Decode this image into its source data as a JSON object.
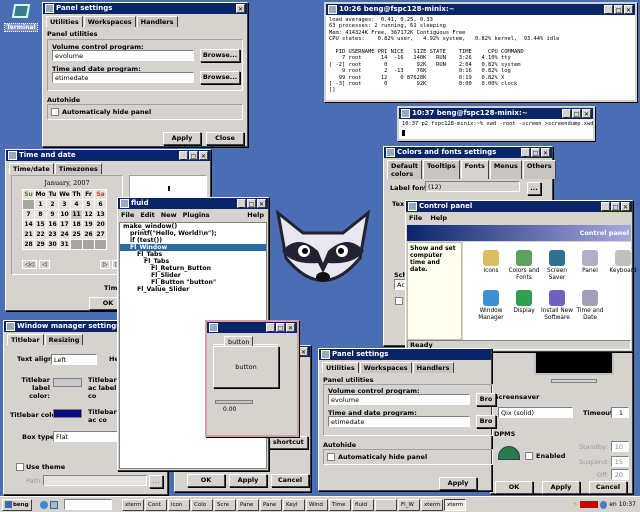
{
  "desktop": {
    "terminal_icon_label": "Terminal"
  },
  "panel_settings_top": {
    "title": "Panel settings",
    "tabs": [
      "Utilities",
      "Workspaces",
      "Handlers"
    ],
    "group_label": "Panel utilities",
    "volume_label": "Volume control program:",
    "volume_value": "evolume",
    "time_label": "Time and date program:",
    "time_value": "etimedate",
    "browse": "Browse...",
    "autohide_label": "Autohide",
    "autohide_check": "Automaticaly hide panel",
    "apply": "Apply",
    "close": "Close"
  },
  "xterm_top": {
    "title": "10:26 beng@fspc128-minix:~",
    "lines": [
      "load averages:  0.41, 0.25, 0.33",
      "63 processes: 2 running, 61 sleeping",
      "Mem: 414324K Free, 367172K Contiguous Free",
      "CPU states:    0.82% user,   4.92% system,   0.82% kernel,  93.44% idle",
      "",
      "  PID USERNAME PRI NICE   SIZE STATE    TIME     CPU COMMAND",
      "    7 root      14  -16   140K   RUN    3:26   4.10% tty",
      "[ -2] root       0         92K   RUN    2:04   0.82% system",
      "    9 root       2  -13    76K          0:16   0.82% log",
      "   99 root      12    0 87628K          0:19   0.82% X",
      "[ -3] root       0         92K          0:00   0.00% clock",
      "[]"
    ]
  },
  "xterm_small": {
    "title": "10:37 beng@fspc128-minix:~",
    "prompt": "10:37 p2 fspc128-minix:~% xwd -root -screen >screendump.xwd"
  },
  "time_and_date": {
    "title": "Time and date",
    "tabs": [
      "Time/date",
      "Timezones"
    ],
    "month": "January, 2007",
    "weekdays": [
      "Su",
      "Mo",
      "Tu",
      "We",
      "Th",
      "Fr",
      "Sa"
    ],
    "days": [
      "",
      "1",
      "2",
      "3",
      "4",
      "5",
      "6",
      "7",
      "8",
      "9",
      "10",
      "11",
      "12",
      "13",
      "14",
      "15",
      "16",
      "17",
      "18",
      "19",
      "20",
      "21",
      "22",
      "23",
      "24",
      "25",
      "26",
      "27",
      "28",
      "29",
      "30",
      "31"
    ],
    "selected_day": "11",
    "nav": [
      "◁◁",
      "◁",
      "▷",
      "▷▷"
    ],
    "time_label_partial": "Tim",
    "ok": "OK"
  },
  "fluid": {
    "title": "fluid",
    "menu": [
      "File",
      "Edit",
      "New",
      "Plugins"
    ],
    "help": "Help",
    "tree": [
      {
        "text": "make_window()",
        "depth": 0,
        "selected": false
      },
      {
        "text": "printf(\"Hello, World!\\n\");",
        "depth": 1,
        "selected": false
      },
      {
        "text": "if (test())",
        "depth": 1,
        "selected": false
      },
      {
        "text": "Fl_Window",
        "depth": 1,
        "selected": true
      },
      {
        "text": "Fl_Tabs",
        "depth": 2,
        "selected": false
      },
      {
        "text": "Fl_Tabs",
        "depth": 3,
        "selected": false
      },
      {
        "text": "Fl_Return_Button",
        "depth": 4,
        "selected": false
      },
      {
        "text": "Fl_Slider",
        "depth": 4,
        "selected": false
      },
      {
        "text": "Fl_Button \"button\"",
        "depth": 4,
        "selected": false
      },
      {
        "text": "Fl_Value_Slider",
        "depth": 2,
        "selected": false
      }
    ]
  },
  "fltk_test_window": {
    "tab_label": "button",
    "button_label": "button",
    "slider_value": "0.00",
    "slider_fraction": 0.0
  },
  "colors_fonts": {
    "title": "Colors and fonts settings",
    "tabs": [
      "Default colors",
      "Tooltips",
      "Fonts",
      "Menus",
      "Others"
    ],
    "label_font_label": "Label font:",
    "label_font_value": "(12)",
    "dots": "...",
    "text_partial": "Tex",
    "scheme_partial": "Sch",
    "scheme_value_partial": "Act",
    "check_partial": "A"
  },
  "control_panel": {
    "title": "Control panel",
    "menu": [
      "File",
      "Help"
    ],
    "banner": "Control panel",
    "description": "Show and set computer time and date.",
    "icons": [
      {
        "label": "Icons",
        "color": "#d8c060"
      },
      {
        "label": "Colors and Fonts",
        "color": "#60a060"
      },
      {
        "label": "Screen Saver",
        "color": "#307090"
      },
      {
        "label": "Panel",
        "color": "#b0b0c8"
      },
      {
        "label": "Keyboard",
        "color": "#c0c0c0"
      },
      {
        "label": "Window Manager",
        "color": "#4090d0"
      },
      {
        "label": "Display",
        "color": "#30a050"
      },
      {
        "label": "Install New Software",
        "color": "#7060c0"
      },
      {
        "label": "Time and Date",
        "color": "#a0a0b8"
      }
    ],
    "status": "Ready"
  },
  "wm_settings": {
    "title": "Window manager settings",
    "tabs": [
      "Titlebar",
      "Resizing"
    ],
    "text_align_label": "Text align:",
    "text_align_value": "Left",
    "height_partial": "Hei",
    "label_color_label": "Titlebar label color:",
    "active_label_partial": "Titlebar ac label co",
    "titlebar_color_label": "Titlebar color:",
    "titlebar_color": "#0a0a80",
    "active_color_partial": "Titlebar ac co",
    "box_type_label": "Box type:",
    "box_type_value": "Flat",
    "use_theme": "Use theme",
    "path_label": "Path:",
    "dots": "..."
  },
  "hidden_dialog": {
    "shortcut_partial": "e shortcut",
    "ok": "OK",
    "apply": "Apply",
    "cancel": "Cancel"
  },
  "panel_settings_bottom": {
    "title": "Panel settings",
    "tabs": [
      "Utilities",
      "Workspaces",
      "Handlers"
    ],
    "group_label": "Panel utilities",
    "volume_label": "Volume control program:",
    "volume_value": "evolume",
    "time_label": "Time and date program:",
    "time_value": "etimedate",
    "browse_partial": "Bro",
    "autohide_label": "Autohide",
    "autohide_check": "Automaticaly hide panel",
    "apply": "Apply"
  },
  "screensaver": {
    "section": "Screensaver",
    "mode": "Qix (solid)",
    "timeout_label": "Timeout:",
    "timeout_value": "1",
    "dpms_label": "DPMS",
    "enabled": "Enabled",
    "standby_label": "Standby:",
    "standby_value": "10",
    "suspend_label": "Suspend:",
    "suspend_value": "15",
    "off_label": "Off:",
    "off_value": "20",
    "ok": "OK",
    "apply": "Apply",
    "cancel": "Cancel"
  },
  "taskbar": {
    "start": "beng",
    "tasks": [
      "xterm",
      "Cont",
      "icon",
      "Colo",
      "Scre",
      "Pane",
      "Pane",
      "Keyl",
      "Wind",
      "Time",
      "fluid",
      "",
      "Fl_W",
      "xterm",
      "xterm"
    ],
    "active_task_index": 14,
    "lang": "en",
    "clock": "10:37"
  }
}
